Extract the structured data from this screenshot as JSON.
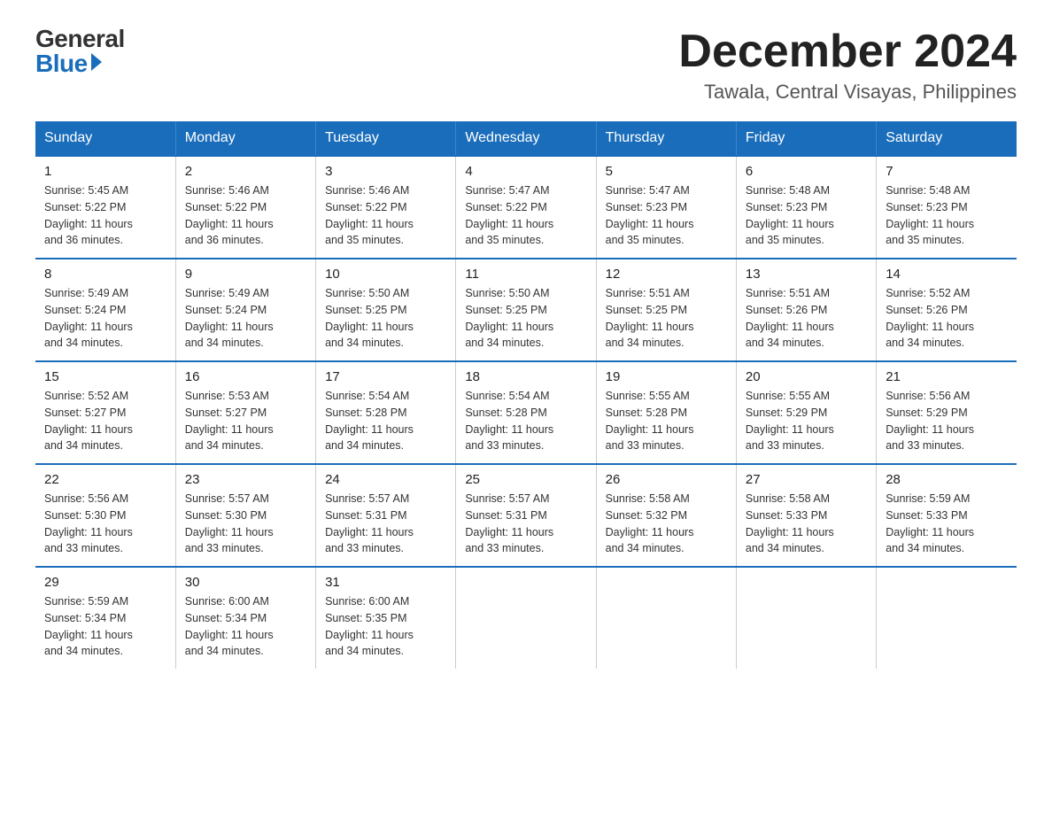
{
  "logo": {
    "general": "General",
    "blue": "Blue"
  },
  "header": {
    "month_year": "December 2024",
    "location": "Tawala, Central Visayas, Philippines"
  },
  "days_of_week": [
    "Sunday",
    "Monday",
    "Tuesday",
    "Wednesday",
    "Thursday",
    "Friday",
    "Saturday"
  ],
  "weeks": [
    [
      {
        "day": "1",
        "sunrise": "5:45 AM",
        "sunset": "5:22 PM",
        "daylight": "11 hours and 36 minutes."
      },
      {
        "day": "2",
        "sunrise": "5:46 AM",
        "sunset": "5:22 PM",
        "daylight": "11 hours and 36 minutes."
      },
      {
        "day": "3",
        "sunrise": "5:46 AM",
        "sunset": "5:22 PM",
        "daylight": "11 hours and 35 minutes."
      },
      {
        "day": "4",
        "sunrise": "5:47 AM",
        "sunset": "5:22 PM",
        "daylight": "11 hours and 35 minutes."
      },
      {
        "day": "5",
        "sunrise": "5:47 AM",
        "sunset": "5:23 PM",
        "daylight": "11 hours and 35 minutes."
      },
      {
        "day": "6",
        "sunrise": "5:48 AM",
        "sunset": "5:23 PM",
        "daylight": "11 hours and 35 minutes."
      },
      {
        "day": "7",
        "sunrise": "5:48 AM",
        "sunset": "5:23 PM",
        "daylight": "11 hours and 35 minutes."
      }
    ],
    [
      {
        "day": "8",
        "sunrise": "5:49 AM",
        "sunset": "5:24 PM",
        "daylight": "11 hours and 34 minutes."
      },
      {
        "day": "9",
        "sunrise": "5:49 AM",
        "sunset": "5:24 PM",
        "daylight": "11 hours and 34 minutes."
      },
      {
        "day": "10",
        "sunrise": "5:50 AM",
        "sunset": "5:25 PM",
        "daylight": "11 hours and 34 minutes."
      },
      {
        "day": "11",
        "sunrise": "5:50 AM",
        "sunset": "5:25 PM",
        "daylight": "11 hours and 34 minutes."
      },
      {
        "day": "12",
        "sunrise": "5:51 AM",
        "sunset": "5:25 PM",
        "daylight": "11 hours and 34 minutes."
      },
      {
        "day": "13",
        "sunrise": "5:51 AM",
        "sunset": "5:26 PM",
        "daylight": "11 hours and 34 minutes."
      },
      {
        "day": "14",
        "sunrise": "5:52 AM",
        "sunset": "5:26 PM",
        "daylight": "11 hours and 34 minutes."
      }
    ],
    [
      {
        "day": "15",
        "sunrise": "5:52 AM",
        "sunset": "5:27 PM",
        "daylight": "11 hours and 34 minutes."
      },
      {
        "day": "16",
        "sunrise": "5:53 AM",
        "sunset": "5:27 PM",
        "daylight": "11 hours and 34 minutes."
      },
      {
        "day": "17",
        "sunrise": "5:54 AM",
        "sunset": "5:28 PM",
        "daylight": "11 hours and 34 minutes."
      },
      {
        "day": "18",
        "sunrise": "5:54 AM",
        "sunset": "5:28 PM",
        "daylight": "11 hours and 33 minutes."
      },
      {
        "day": "19",
        "sunrise": "5:55 AM",
        "sunset": "5:28 PM",
        "daylight": "11 hours and 33 minutes."
      },
      {
        "day": "20",
        "sunrise": "5:55 AM",
        "sunset": "5:29 PM",
        "daylight": "11 hours and 33 minutes."
      },
      {
        "day": "21",
        "sunrise": "5:56 AM",
        "sunset": "5:29 PM",
        "daylight": "11 hours and 33 minutes."
      }
    ],
    [
      {
        "day": "22",
        "sunrise": "5:56 AM",
        "sunset": "5:30 PM",
        "daylight": "11 hours and 33 minutes."
      },
      {
        "day": "23",
        "sunrise": "5:57 AM",
        "sunset": "5:30 PM",
        "daylight": "11 hours and 33 minutes."
      },
      {
        "day": "24",
        "sunrise": "5:57 AM",
        "sunset": "5:31 PM",
        "daylight": "11 hours and 33 minutes."
      },
      {
        "day": "25",
        "sunrise": "5:57 AM",
        "sunset": "5:31 PM",
        "daylight": "11 hours and 33 minutes."
      },
      {
        "day": "26",
        "sunrise": "5:58 AM",
        "sunset": "5:32 PM",
        "daylight": "11 hours and 34 minutes."
      },
      {
        "day": "27",
        "sunrise": "5:58 AM",
        "sunset": "5:33 PM",
        "daylight": "11 hours and 34 minutes."
      },
      {
        "day": "28",
        "sunrise": "5:59 AM",
        "sunset": "5:33 PM",
        "daylight": "11 hours and 34 minutes."
      }
    ],
    [
      {
        "day": "29",
        "sunrise": "5:59 AM",
        "sunset": "5:34 PM",
        "daylight": "11 hours and 34 minutes."
      },
      {
        "day": "30",
        "sunrise": "6:00 AM",
        "sunset": "5:34 PM",
        "daylight": "11 hours and 34 minutes."
      },
      {
        "day": "31",
        "sunrise": "6:00 AM",
        "sunset": "5:35 PM",
        "daylight": "11 hours and 34 minutes."
      },
      null,
      null,
      null,
      null
    ]
  ],
  "labels": {
    "sunrise": "Sunrise:",
    "sunset": "Sunset:",
    "daylight": "Daylight:"
  }
}
